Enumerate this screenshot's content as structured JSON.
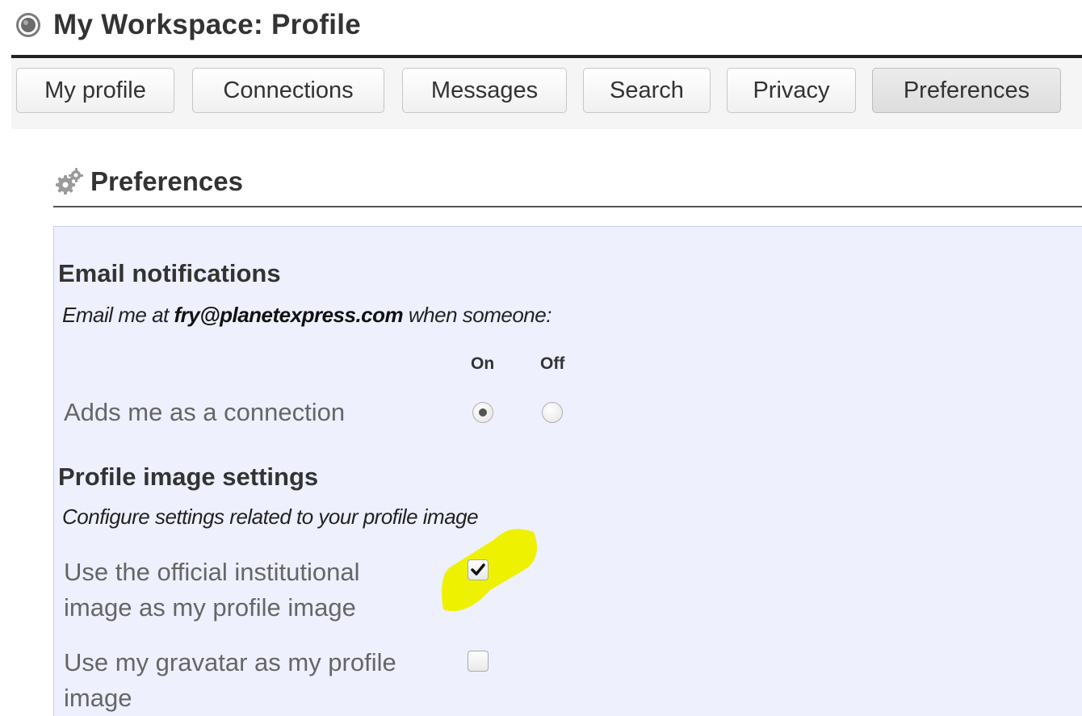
{
  "header": {
    "title": "My Workspace: Profile"
  },
  "tabs": [
    {
      "label": "My profile",
      "active": false
    },
    {
      "label": "Connections",
      "active": false
    },
    {
      "label": "Messages",
      "active": false
    },
    {
      "label": "Search",
      "active": false
    },
    {
      "label": "Privacy",
      "active": false
    },
    {
      "label": "Preferences",
      "active": true
    }
  ],
  "section": {
    "icon": "gear-icon",
    "title": "Preferences"
  },
  "email_notifications": {
    "title": "Email notifications",
    "desc_prefix": "Email me at",
    "email": "fry@planetexpress.com",
    "desc_suffix": "when someone:",
    "col_on": "On",
    "col_off": "Off",
    "rows": [
      {
        "label": "Adds me as a connection",
        "value": "On"
      }
    ]
  },
  "profile_image": {
    "title": "Profile image settings",
    "desc": "Configure settings related to your profile image",
    "options": [
      {
        "label_line1": "Use the official institutional",
        "label_line2": "image as my profile image",
        "checked": true
      },
      {
        "label_line1": "Use my gravatar as my profile",
        "label_line2": "image",
        "checked": false
      }
    ]
  },
  "colors": {
    "panel_bg": "#eef0fe",
    "highlight": "#eef200"
  }
}
